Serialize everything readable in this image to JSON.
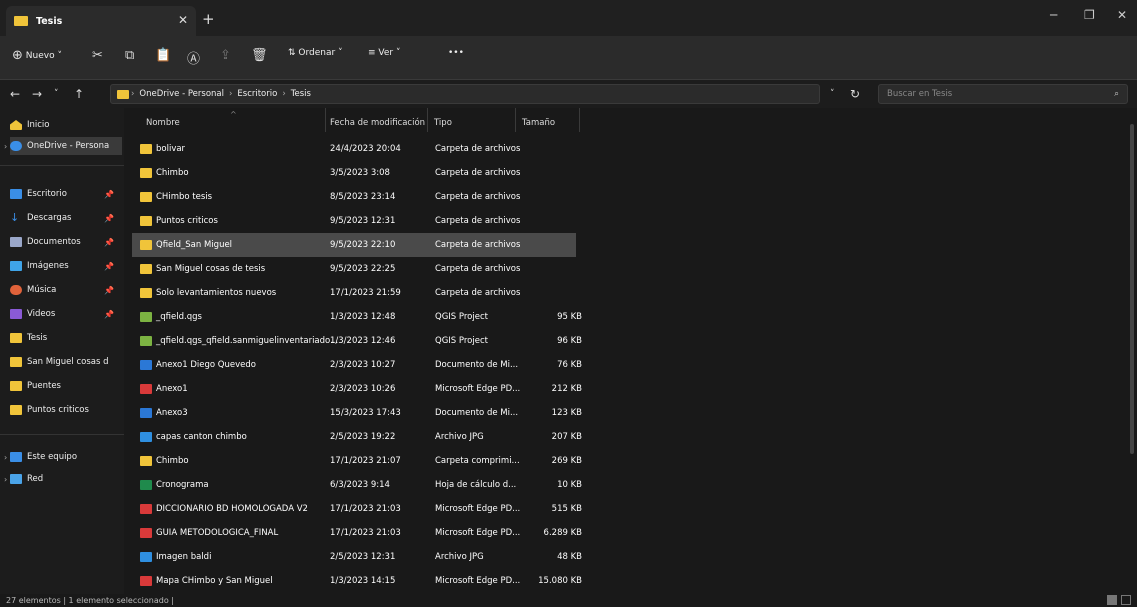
{
  "window": {
    "tab_title": "Tesis",
    "new_tab": "+"
  },
  "toolbar": {
    "new_label": "Nuevo",
    "sort_label": "Ordenar",
    "view_label": "Ver",
    "more": "•••"
  },
  "address": {
    "crumbs": [
      "OneDrive - Personal",
      "Escritorio",
      "Tesis"
    ]
  },
  "search": {
    "placeholder": "Buscar en Tesis"
  },
  "sidebar": {
    "items": [
      {
        "label": "Inicio"
      },
      {
        "label": "OneDrive - Persona"
      },
      {
        "label": "Escritorio"
      },
      {
        "label": "Descargas"
      },
      {
        "label": "Documentos"
      },
      {
        "label": "Imágenes"
      },
      {
        "label": "Música"
      },
      {
        "label": "Videos"
      },
      {
        "label": "Tesis"
      },
      {
        "label": "San Miguel cosas d"
      },
      {
        "label": "Puentes"
      },
      {
        "label": "Puntos criticos"
      },
      {
        "label": "Este equipo"
      },
      {
        "label": "Red"
      }
    ]
  },
  "columns": {
    "name": "Nombre",
    "date": "Fecha de modificación",
    "type": "Tipo",
    "size": "Tamaño"
  },
  "files": [
    {
      "name": "bolivar",
      "date": "24/4/2023 20:04",
      "type": "Carpeta de archivos",
      "size": "",
      "icon": "folder"
    },
    {
      "name": "Chimbo",
      "date": "3/5/2023 3:08",
      "type": "Carpeta de archivos",
      "size": "",
      "icon": "folder"
    },
    {
      "name": "CHimbo tesis",
      "date": "8/5/2023 23:14",
      "type": "Carpeta de archivos",
      "size": "",
      "icon": "folder"
    },
    {
      "name": "Puntos criticos",
      "date": "9/5/2023 12:31",
      "type": "Carpeta de archivos",
      "size": "",
      "icon": "folder"
    },
    {
      "name": "Qfield_San Miguel",
      "date": "9/5/2023 22:10",
      "type": "Carpeta de archivos",
      "size": "",
      "icon": "folder"
    },
    {
      "name": "San Miguel cosas de tesis",
      "date": "9/5/2023 22:25",
      "type": "Carpeta de archivos",
      "size": "",
      "icon": "folder"
    },
    {
      "name": "Solo levantamientos nuevos",
      "date": "17/1/2023 21:59",
      "type": "Carpeta de archivos",
      "size": "",
      "icon": "folder"
    },
    {
      "name": "_qfield.qgs",
      "date": "1/3/2023 12:48",
      "type": "QGIS Project",
      "size": "95 KB",
      "icon": "qgis"
    },
    {
      "name": "_qfield.qgs_qfield.sanmiguelinventariado...",
      "date": "1/3/2023 12:46",
      "type": "QGIS Project",
      "size": "96 KB",
      "icon": "qgis"
    },
    {
      "name": "Anexo1 Diego Quevedo",
      "date": "2/3/2023 10:27",
      "type": "Documento de Mi...",
      "size": "76 KB",
      "icon": "word"
    },
    {
      "name": "Anexo1",
      "date": "2/3/2023 10:26",
      "type": "Microsoft Edge PD...",
      "size": "212 KB",
      "icon": "pdf"
    },
    {
      "name": "Anexo3",
      "date": "15/3/2023 17:43",
      "type": "Documento de Mi...",
      "size": "123 KB",
      "icon": "word"
    },
    {
      "name": "capas canton chimbo",
      "date": "2/5/2023 19:22",
      "type": "Archivo JPG",
      "size": "207 KB",
      "icon": "jpg"
    },
    {
      "name": "Chimbo",
      "date": "17/1/2023 21:07",
      "type": "Carpeta comprimi...",
      "size": "269 KB",
      "icon": "zip"
    },
    {
      "name": "Cronograma",
      "date": "6/3/2023 9:14",
      "type": "Hoja de cálculo d...",
      "size": "10 KB",
      "icon": "excel"
    },
    {
      "name": "DICCIONARIO BD HOMOLOGADA V2",
      "date": "17/1/2023 21:03",
      "type": "Microsoft Edge PD...",
      "size": "515 KB",
      "icon": "pdf"
    },
    {
      "name": "GUIA METODOLOGICA_FINAL",
      "date": "17/1/2023 21:03",
      "type": "Microsoft Edge PD...",
      "size": "6.289 KB",
      "icon": "pdf"
    },
    {
      "name": "Imagen baldi",
      "date": "2/5/2023 12:31",
      "type": "Archivo JPG",
      "size": "48 KB",
      "icon": "jpg"
    },
    {
      "name": "Mapa CHimbo y San Miguel",
      "date": "1/3/2023 14:15",
      "type": "Microsoft Edge PD...",
      "size": "15.080 KB",
      "icon": "pdf"
    }
  ],
  "status": {
    "text": "27 elementos  |  1 elemento seleccionado  |"
  },
  "colors": {
    "folder": "#f0c43a",
    "qgis": "#7cb342",
    "word": "#2b78d6",
    "pdf": "#d93a3a",
    "jpg": "#2f8fe0",
    "excel": "#1f8a4c",
    "selected": "#4a4a4a"
  }
}
